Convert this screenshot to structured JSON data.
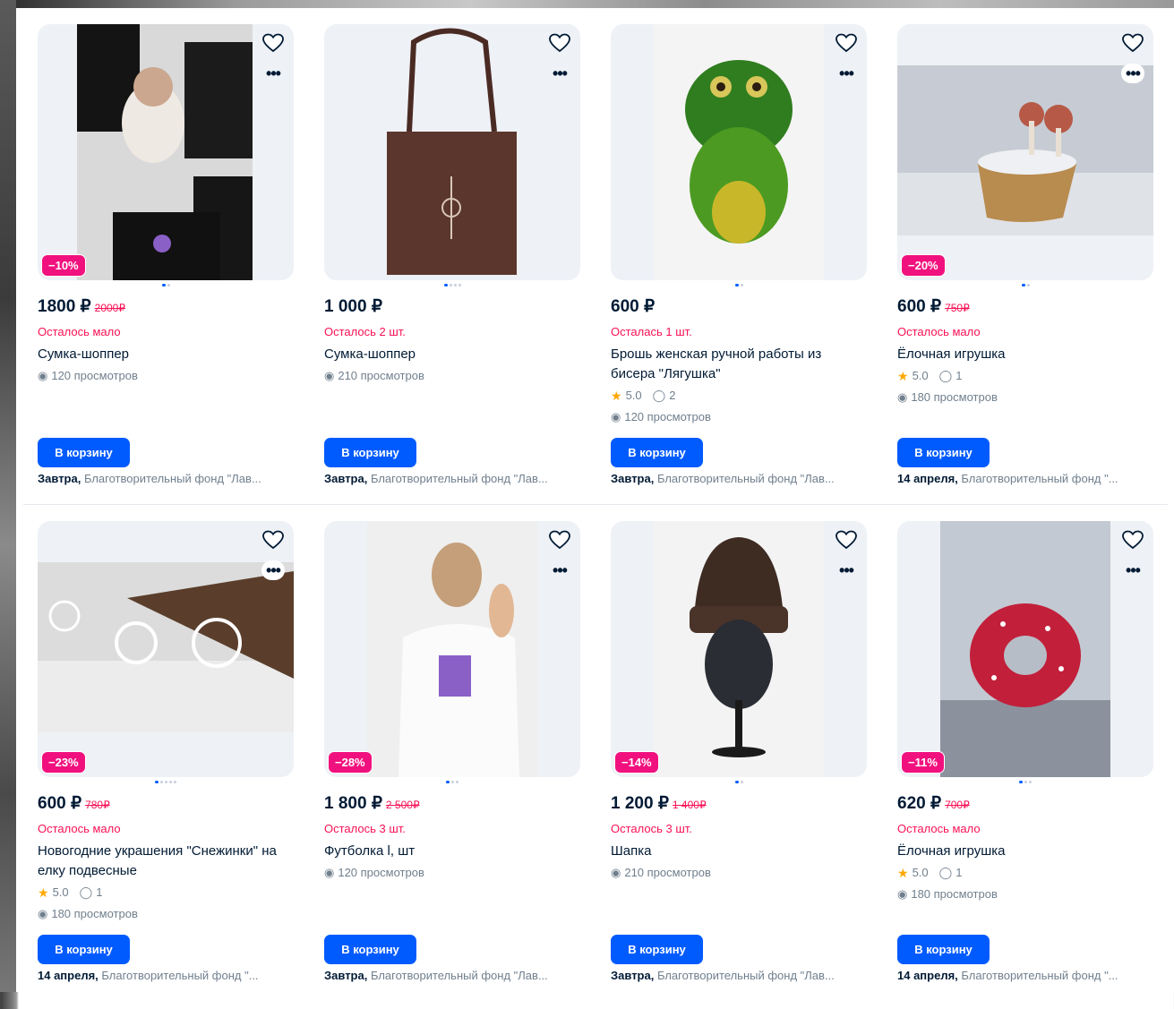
{
  "colors": {
    "accent": "#005bff",
    "discount": "#f1117e",
    "stock": "#f91155",
    "text": "#001a34",
    "muted": "#707f8d",
    "star": "#ffa800"
  },
  "icons": {
    "favorite": "heart-icon",
    "more": "ellipsis-icon",
    "views": "eye-icon",
    "rating": "star-icon",
    "comments": "comment-icon"
  },
  "products": [
    {
      "price": "1800 ₽",
      "old_price": "2000₽",
      "badge": "−10%",
      "stock": "Осталось мало",
      "title": "Сумка-шоппер",
      "rating": "",
      "comments": "",
      "views": "120 просмотров",
      "cart": "В корзину",
      "delivery_day": "Завтра,",
      "delivery_seller": " Благотворительный фонд \"Лав...",
      "image_count": 2,
      "image_index": 1
    },
    {
      "price": "1 000 ₽",
      "old_price": "",
      "badge": "",
      "stock": "Осталось 2 шт.",
      "title": "Сумка-шоппер",
      "rating": "",
      "comments": "",
      "views": "210 просмотров",
      "cart": "В корзину",
      "delivery_day": "Завтра,",
      "delivery_seller": " Благотворительный фонд \"Лав...",
      "image_count": 4,
      "image_index": 1
    },
    {
      "price": "600 ₽",
      "old_price": "",
      "badge": "",
      "stock": "Осталась 1 шт.",
      "title": "Брошь женская ручной работы из бисера \"Лягушка\"",
      "rating": "5.0",
      "comments": "2",
      "views": "120 просмотров",
      "cart": "В корзину",
      "delivery_day": "Завтра,",
      "delivery_seller": " Благотворительный фонд \"Лав...",
      "image_count": 2,
      "image_index": 1
    },
    {
      "price": "600 ₽",
      "old_price": "750₽",
      "badge": "−20%",
      "stock": "Осталось мало",
      "title": "Ёлочная игрушка",
      "rating": "5.0",
      "comments": "1",
      "views": "180 просмотров",
      "cart": "В корзину",
      "delivery_day": "14 апреля,",
      "delivery_seller": " Благотворительный фонд \"...",
      "image_count": 2,
      "image_index": 1
    },
    {
      "price": "600 ₽",
      "old_price": "780₽",
      "badge": "−23%",
      "stock": "Осталось мало",
      "title": "Новогодние украшения \"Снежинки\" на елку подвесные",
      "rating": "5.0",
      "comments": "1",
      "views": "180 просмотров",
      "cart": "В корзину",
      "delivery_day": "14 апреля,",
      "delivery_seller": " Благотворительный фонд \"...",
      "image_count": 5,
      "image_index": 1
    },
    {
      "price": "1 800 ₽",
      "old_price": "2 500₽",
      "badge": "−28%",
      "stock": "Осталось 3 шт.",
      "title": "Футболка l, шт",
      "rating": "",
      "comments": "",
      "views": "120 просмотров",
      "cart": "В корзину",
      "delivery_day": "Завтра,",
      "delivery_seller": " Благотворительный фонд \"Лав...",
      "image_count": 3,
      "image_index": 1
    },
    {
      "price": "1 200 ₽",
      "old_price": "1 400₽",
      "badge": "−14%",
      "stock": "Осталось 3 шт.",
      "title": "Шапка",
      "rating": "",
      "comments": "",
      "views": "210 просмотров",
      "cart": "В корзину",
      "delivery_day": "Завтра,",
      "delivery_seller": " Благотворительный фонд \"Лав...",
      "image_count": 2,
      "image_index": 1
    },
    {
      "price": "620 ₽",
      "old_price": "700₽",
      "badge": "−11%",
      "stock": "Осталось мало",
      "title": "Ёлочная игрушка",
      "rating": "5.0",
      "comments": "1",
      "views": "180 просмотров",
      "cart": "В корзину",
      "delivery_day": "14 апреля,",
      "delivery_seller": " Благотворительный фонд \"...",
      "image_count": 3,
      "image_index": 1
    }
  ]
}
